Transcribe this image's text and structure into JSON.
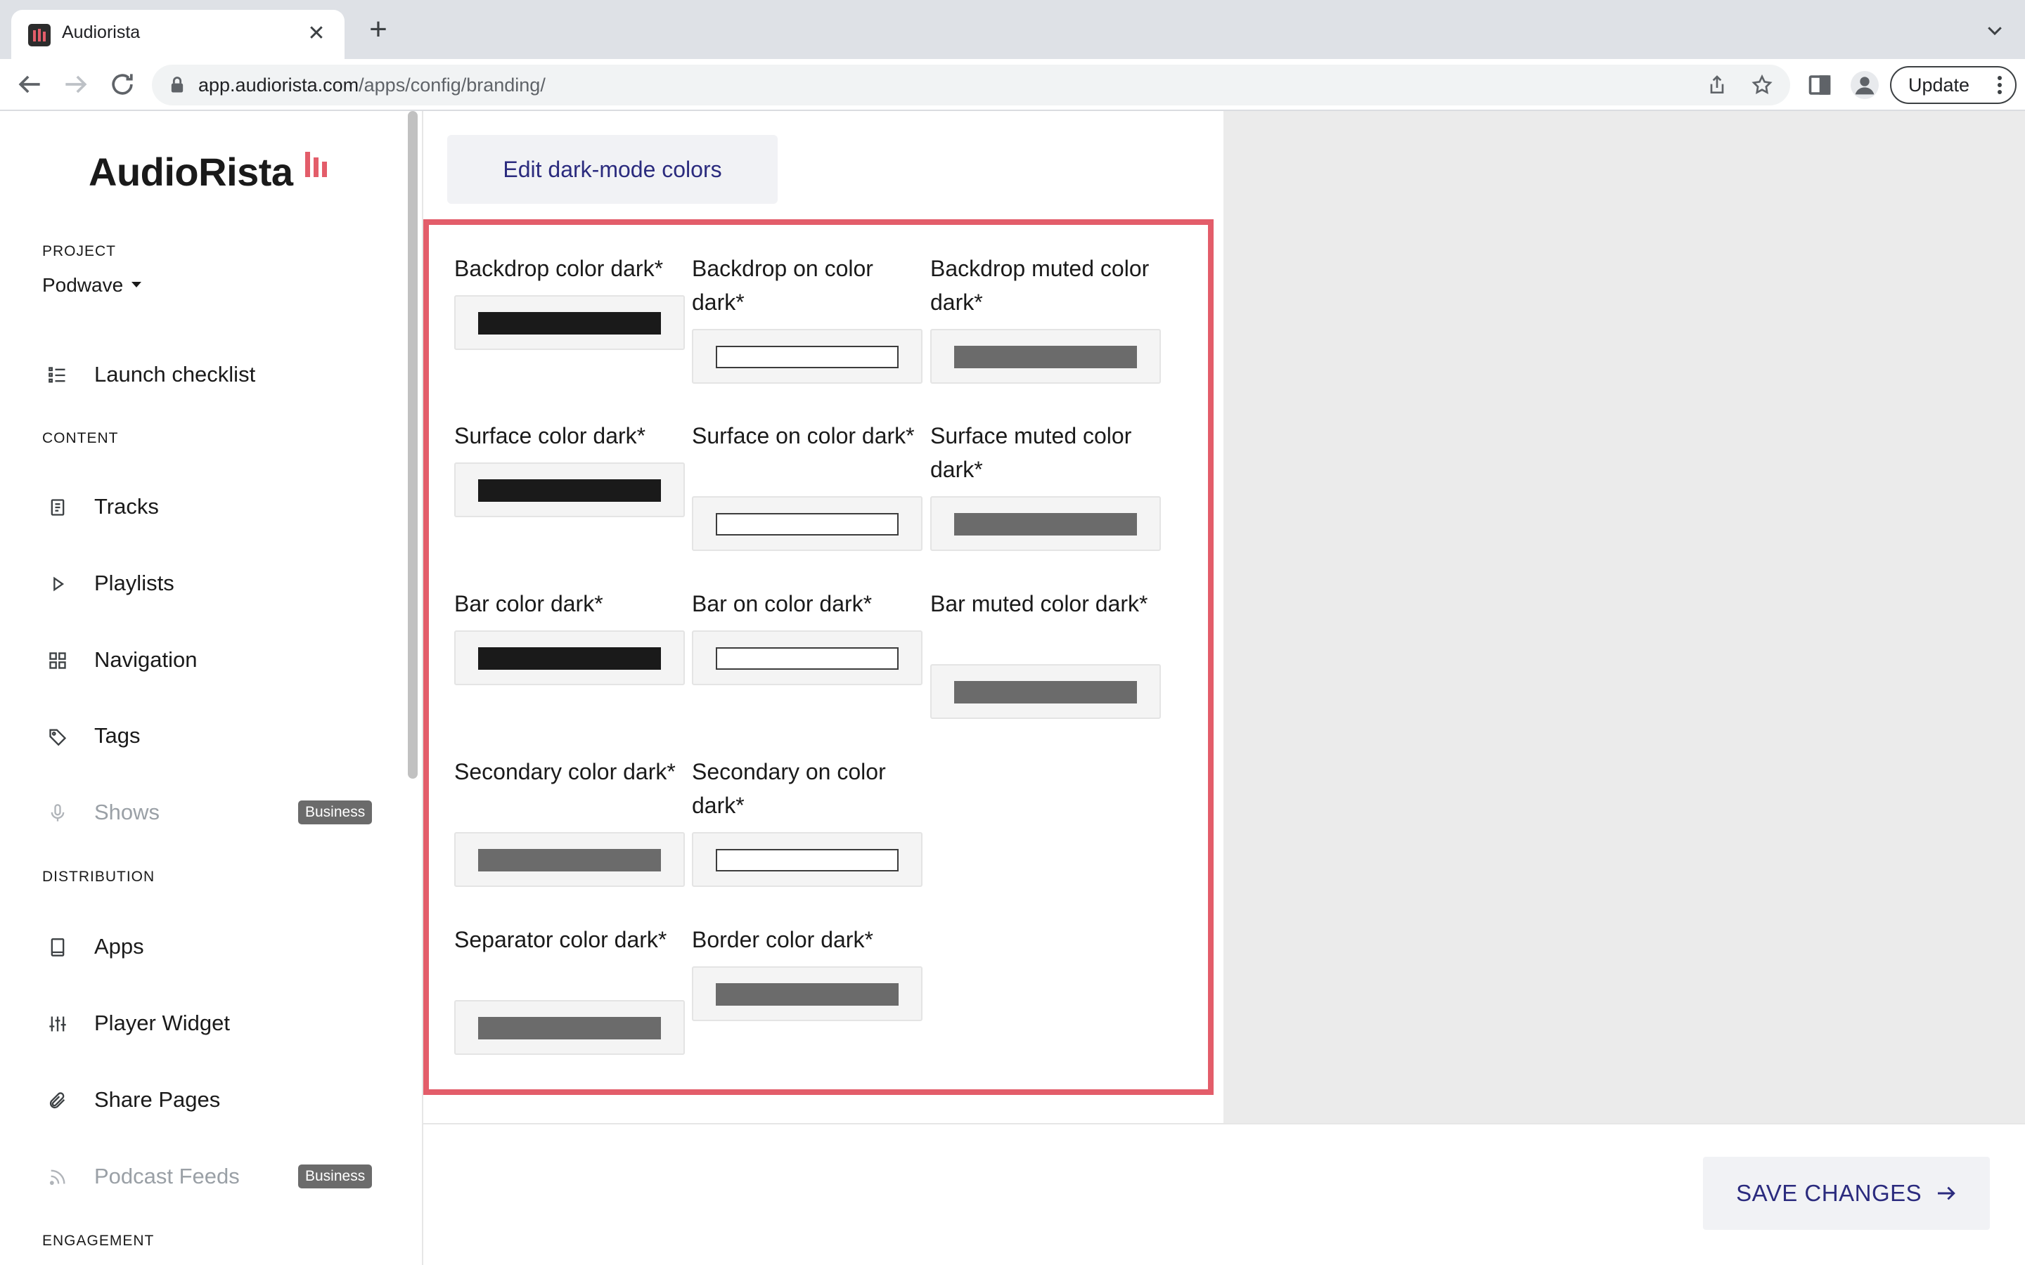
{
  "browser": {
    "tab_title": "Audiorista",
    "tab_close": "✕",
    "new_tab": "+",
    "url_host": "app.audiorista.com",
    "url_path": "/apps/config/branding/",
    "update_label": "Update"
  },
  "sidebar": {
    "logo_text": "AudioRista",
    "project_label": "PROJECT",
    "project_name": "Podwave",
    "launch_checklist": "Launch checklist",
    "content_label": "CONTENT",
    "content_items": [
      {
        "label": "Tracks",
        "icon": "document-icon"
      },
      {
        "label": "Playlists",
        "icon": "play-icon"
      },
      {
        "label": "Navigation",
        "icon": "grid-icon"
      },
      {
        "label": "Tags",
        "icon": "tag-icon"
      },
      {
        "label": "Shows",
        "icon": "microphone-icon",
        "badge": "Business"
      }
    ],
    "distribution_label": "DISTRIBUTION",
    "distribution_items": [
      {
        "label": "Apps",
        "icon": "tablet-icon"
      },
      {
        "label": "Player Widget",
        "icon": "sliders-icon"
      },
      {
        "label": "Share Pages",
        "icon": "paperclip-icon"
      },
      {
        "label": "Podcast Feeds",
        "icon": "rss-icon",
        "badge": "Business"
      }
    ],
    "engagement_label": "ENGAGEMENT"
  },
  "main": {
    "edit_dark_mode_button": "Edit dark-mode colors",
    "fields": [
      {
        "label": "Backdrop color dark*",
        "color": "#1a1a1a"
      },
      {
        "label": "Backdrop on color dark*",
        "color": "#ffffff"
      },
      {
        "label": "Backdrop muted color dark*",
        "color": "#6b6b6b"
      },
      {
        "label": "Surface color dark*",
        "color": "#1a1a1a"
      },
      {
        "label": "Surface on color dark*",
        "color": "#ffffff"
      },
      {
        "label": "Surface muted color dark*",
        "color": "#6b6b6b"
      },
      {
        "label": "Bar color dark*",
        "color": "#1a1a1a"
      },
      {
        "label": "Bar on color dark*",
        "color": "#ffffff"
      },
      {
        "label": "Bar muted color dark*",
        "color": "#6b6b6b"
      },
      {
        "label": "Secondary color dark*",
        "color": "#6b6b6b"
      },
      {
        "label": "Secondary on color dark*",
        "color": "#ffffff"
      },
      {
        "label": "Separator color dark*",
        "color": "#6b6b6b"
      },
      {
        "label": "Border color dark*",
        "color": "#6b6b6b"
      }
    ],
    "highlight_color": "#e35d6a"
  },
  "footer": {
    "save_button": "SAVE CHANGES"
  }
}
